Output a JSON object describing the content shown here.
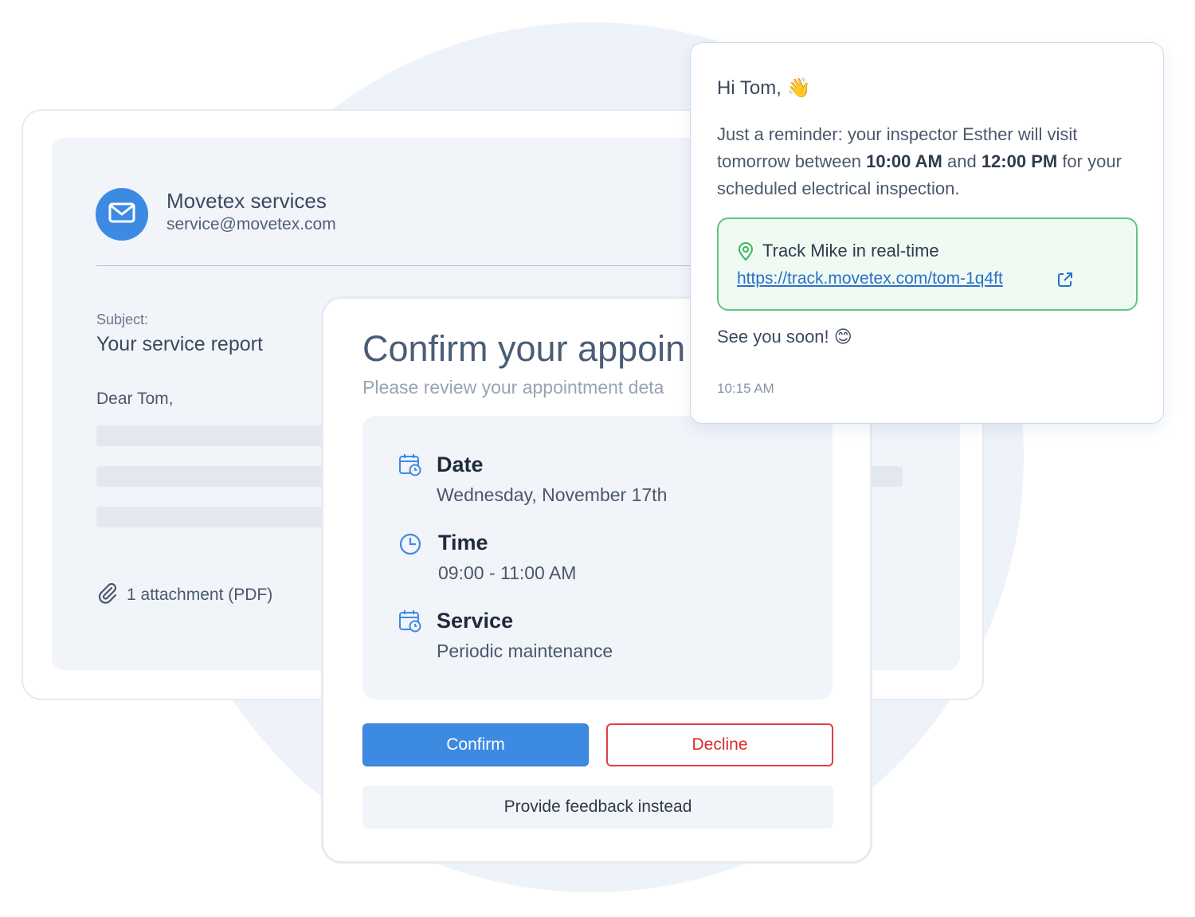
{
  "email": {
    "sender_name": "Movetex services",
    "sender_email": "service@movetex.com",
    "subject_label": "Subject:",
    "subject": "Your service report",
    "greeting": "Dear Tom,",
    "attachment": "1 attachment (PDF)"
  },
  "appointment": {
    "title": "Confirm your appoin",
    "subtitle": "Please review your appointment deta",
    "details": [
      {
        "label": "Date",
        "value": "Wednesday, November 17th",
        "icon": "calendar-clock-icon"
      },
      {
        "label": "Time",
        "value": "09:00 - 11:00 AM",
        "icon": "clock-icon"
      },
      {
        "label": "Service",
        "value": "Periodic maintenance",
        "icon": "calendar-clock-icon"
      }
    ],
    "confirm_label": "Confirm",
    "decline_label": "Decline",
    "feedback_label": "Provide feedback instead"
  },
  "chat": {
    "greeting": "Hi Tom,",
    "greeting_emoji": "👋",
    "message_part1": "Just a reminder: your inspector Esther will visit tomorrow between ",
    "time_start": "10:00 AM",
    "message_and": " and ",
    "time_end": "12:00 PM",
    "message_part2": " for your scheduled electrical inspection.",
    "track_title": "Track Mike in real-time",
    "track_link": "https://track.movetex.com/tom-1q4ft",
    "farewell": "See you soon!",
    "farewell_emoji": "😊",
    "timestamp": "10:15 AM"
  },
  "colors": {
    "accent": "#3d8ae3",
    "decline": "#e04040",
    "track_border": "#5fc77a",
    "background_circle": "#eef2f9"
  }
}
